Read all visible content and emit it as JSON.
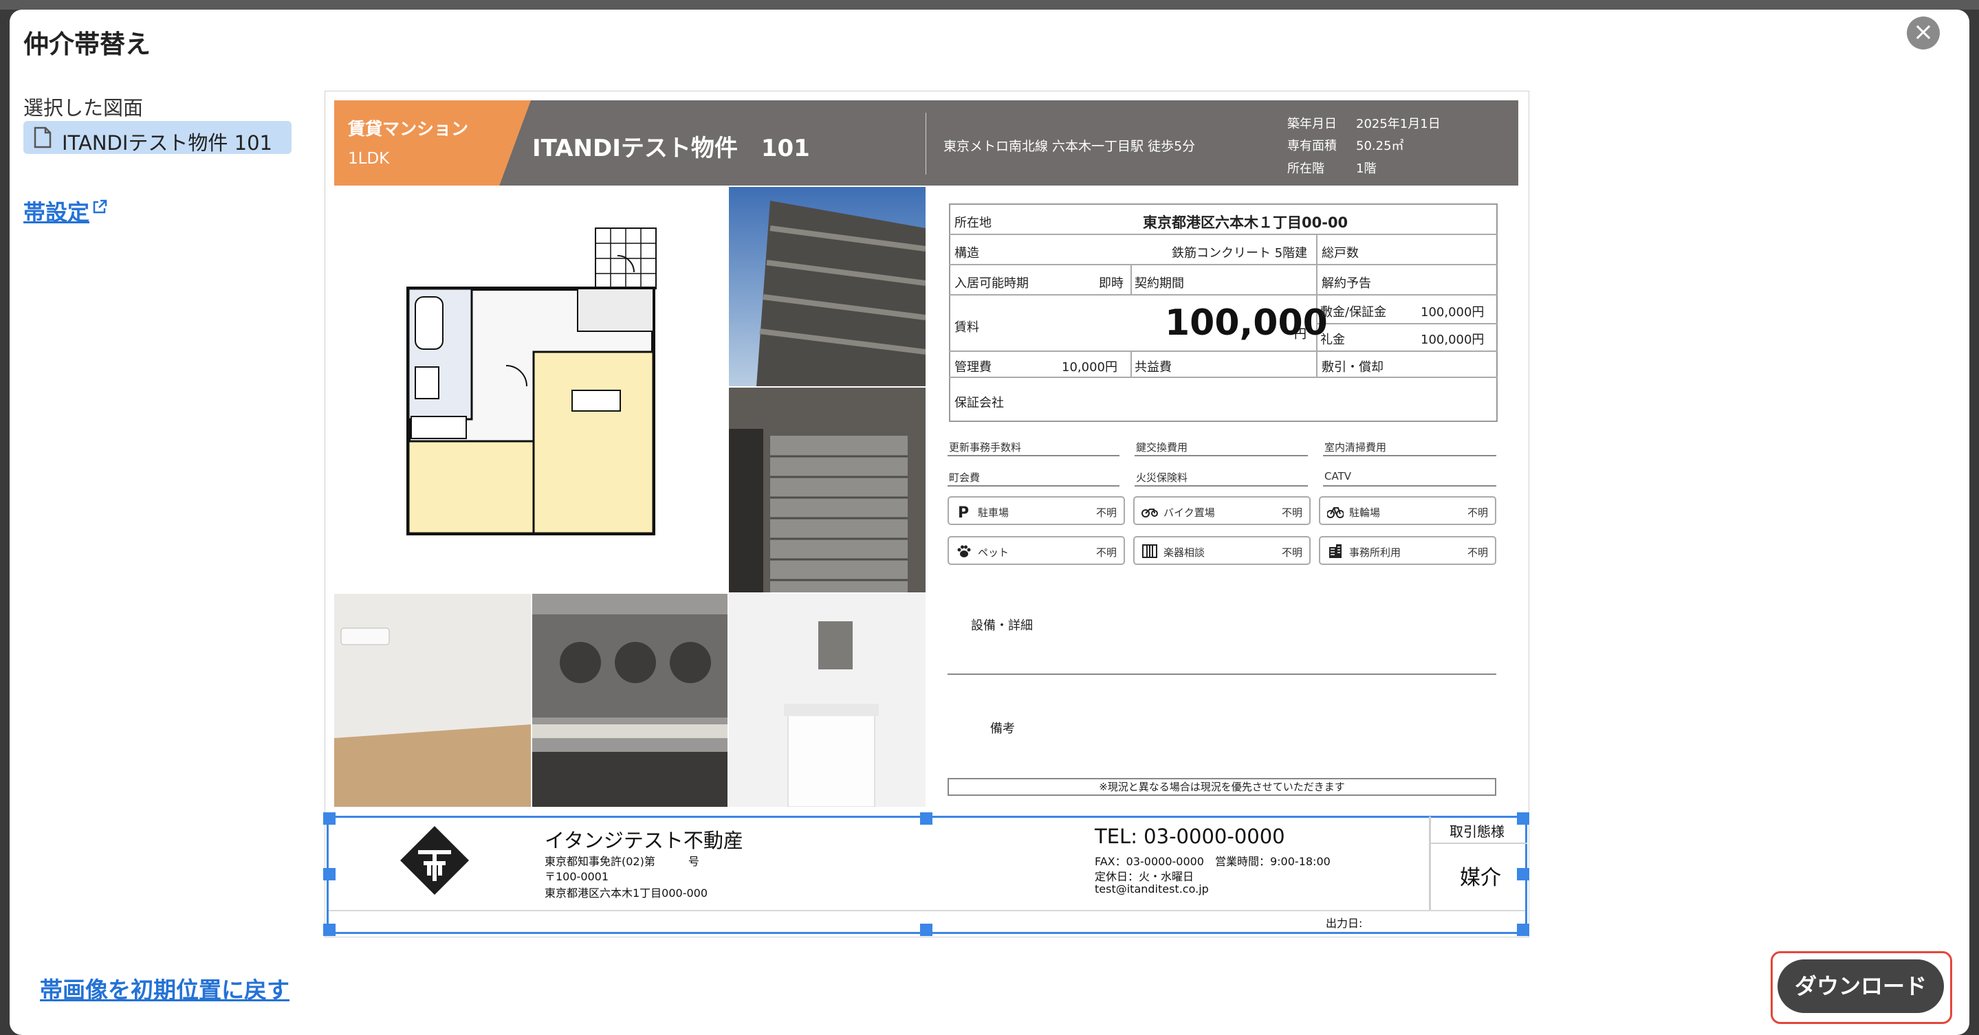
{
  "modal": {
    "title": "仲介帯替え",
    "close_label": "×"
  },
  "sidebar": {
    "selected_label": "選択した図面",
    "file_name": "ITANDIテスト物件 101",
    "band_setting_link": "帯設定"
  },
  "actions": {
    "reset_label": "帯画像を初期位置に戻す",
    "download_label": "ダウンロード"
  },
  "sheet": {
    "header": {
      "type": "賃貸マンション",
      "layout": "1LDK",
      "property_name": "ITANDIテスト物件　101",
      "station": "東京メトロ南北線 六本木一丁目駅 徒歩5分",
      "built_label": "築年月日",
      "built_value": "2025年1月1日",
      "area_label": "専有面積",
      "area_value": "50.25㎡",
      "floor_label": "所在階",
      "floor_value": "1階"
    },
    "table": {
      "address_label": "所在地",
      "address_value": "東京都港区六本木１丁目00-00",
      "structure_label": "構造",
      "structure_value": "鉄筋コンクリート 5階建",
      "units_label": "総戸数",
      "movein_label": "入居可能時期",
      "movein_value": "即時",
      "contract_label": "契約期間",
      "cancel_label": "解約予告",
      "rent_label": "賃料",
      "rent_value": "100,000",
      "rent_unit": "円",
      "deposit_label": "敷金/保証金",
      "deposit_value": "100,000円",
      "keymoney_label": "礼金",
      "keymoney_value": "100,000円",
      "mgmt_label": "管理費",
      "mgmt_value": "10,000円",
      "common_label": "共益費",
      "deduction_label": "敷引・償却",
      "guarantor_label": "保証会社"
    },
    "fees": [
      "更新事務手数料",
      "鍵交換費用",
      "室内清掃費用",
      "町会費",
      "火災保険料",
      "CATV"
    ],
    "chips": [
      {
        "icon": "parking-icon",
        "label": "駐車場",
        "value": "不明"
      },
      {
        "icon": "motorcycle-icon",
        "label": "バイク置場",
        "value": "不明"
      },
      {
        "icon": "bicycle-icon",
        "label": "駐輪場",
        "value": "不明"
      },
      {
        "icon": "paw-icon",
        "label": "ペット",
        "value": "不明"
      },
      {
        "icon": "piano-icon",
        "label": "楽器相談",
        "value": "不明"
      },
      {
        "icon": "building-icon",
        "label": "事務所利用",
        "value": "不明"
      }
    ],
    "equipment_label": "設備・詳細",
    "remarks_label": "備考",
    "note": "※現況と異なる場合は現況を優先させていただきます"
  },
  "footer": {
    "agency_name": "イタンジテスト不動産",
    "license": "東京都知事免許(02)第　　　号",
    "postal": "〒100-0001",
    "address": "東京都港区六本木1丁目000-000",
    "tel": "TEL: 03-0000-0000",
    "fax_hours": "FAX：03-0000-0000　営業時間：9:00-18:00",
    "holiday": "定休日：火・水曜日",
    "email": "test@itanditest.co.jp",
    "transaction_label": "取引態様",
    "transaction_value": "媒介",
    "output_date_label": "出力日:"
  },
  "colors": {
    "accent": "#2472d6",
    "header_bar": "#6f6c6b",
    "tag": "#ef9552",
    "selection": "#3b86e6",
    "download_outline": "#e3473a"
  }
}
